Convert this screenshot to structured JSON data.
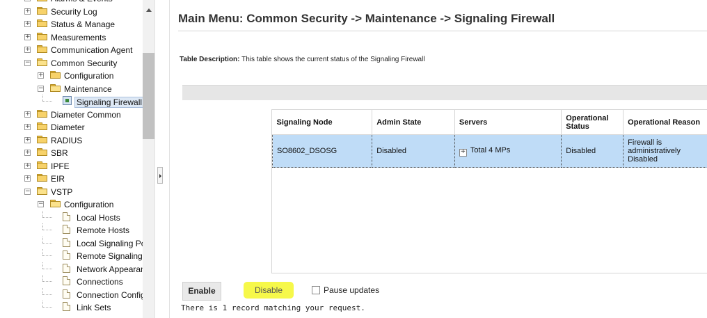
{
  "tree": {
    "items": [
      {
        "label": "Alarms & Events",
        "level": 0,
        "kind": "folder",
        "expander": "+"
      },
      {
        "label": "Security Log",
        "level": 0,
        "kind": "folder",
        "expander": "+"
      },
      {
        "label": "Status & Manage",
        "level": 0,
        "kind": "folder",
        "expander": "+"
      },
      {
        "label": "Measurements",
        "level": 0,
        "kind": "folder",
        "expander": "+"
      },
      {
        "label": "Communication Agent",
        "level": 0,
        "kind": "folder",
        "expander": "+"
      },
      {
        "label": "Common Security",
        "level": 0,
        "kind": "folder-open",
        "expander": "−"
      },
      {
        "label": "Configuration",
        "level": 1,
        "kind": "folder",
        "expander": "+"
      },
      {
        "label": "Maintenance",
        "level": 1,
        "kind": "folder-open",
        "expander": "−"
      },
      {
        "label": "Signaling Firewall",
        "level": 2,
        "kind": "leaf",
        "selected": true
      },
      {
        "label": "Diameter Common",
        "level": 0,
        "kind": "folder",
        "expander": "+"
      },
      {
        "label": "Diameter",
        "level": 0,
        "kind": "folder",
        "expander": "+"
      },
      {
        "label": "RADIUS",
        "level": 0,
        "kind": "folder",
        "expander": "+"
      },
      {
        "label": "SBR",
        "level": 0,
        "kind": "folder",
        "expander": "+"
      },
      {
        "label": "IPFE",
        "level": 0,
        "kind": "folder",
        "expander": "+"
      },
      {
        "label": "EIR",
        "level": 0,
        "kind": "folder",
        "expander": "+"
      },
      {
        "label": "VSTP",
        "level": 0,
        "kind": "folder-open",
        "expander": "−"
      },
      {
        "label": "Configuration",
        "level": 1,
        "kind": "folder-open",
        "expander": "−"
      },
      {
        "label": "Local Hosts",
        "level": 2,
        "kind": "doc"
      },
      {
        "label": "Remote Hosts",
        "level": 2,
        "kind": "doc"
      },
      {
        "label": "Local Signaling Poir",
        "level": 2,
        "kind": "doc"
      },
      {
        "label": "Remote Signaling P",
        "level": 2,
        "kind": "doc"
      },
      {
        "label": "Network Appearanc",
        "level": 2,
        "kind": "doc"
      },
      {
        "label": "Connections",
        "level": 2,
        "kind": "doc"
      },
      {
        "label": "Connection Configu",
        "level": 2,
        "kind": "doc"
      },
      {
        "label": "Link Sets",
        "level": 2,
        "kind": "doc"
      }
    ]
  },
  "main": {
    "title": "Main Menu: Common Security -> Maintenance -> Signaling Firewall",
    "desc_label": "Table Description:",
    "desc_text": " This table shows the current status of the Signaling Firewall",
    "table": {
      "headers": [
        "Signaling Node",
        "Admin State",
        "Servers",
        "Operational Status",
        "Operational Reason"
      ],
      "rows": [
        {
          "node": "SO8602_DSOSG",
          "admin": "Disabled",
          "servers": "Total 4 MPs",
          "status": "Disabled",
          "reason": "Firewall is administratively Disabled"
        }
      ]
    },
    "buttons": {
      "enable": "Enable",
      "disable": "Disable"
    },
    "pause_label": "Pause updates",
    "records": "There is 1 record matching your request."
  },
  "colors": {
    "selected_row": "#bfdcf7",
    "highlight": "#f6f84a"
  }
}
